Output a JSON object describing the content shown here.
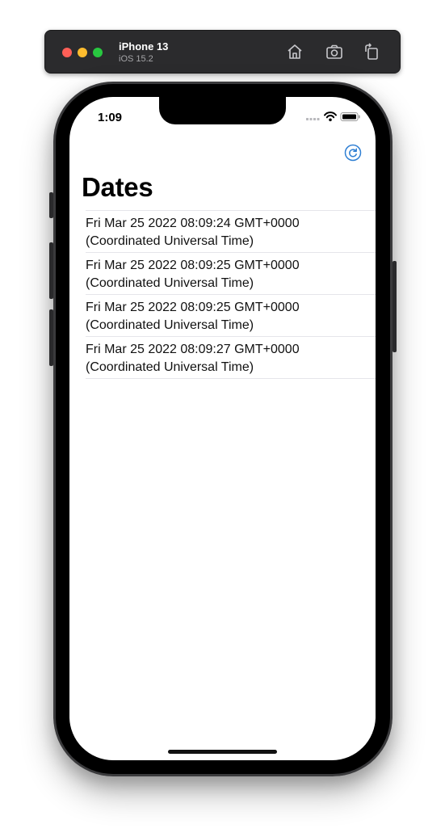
{
  "toolbar": {
    "device_name": "iPhone 13",
    "os_version": "iOS 15.2",
    "icons": [
      "home-icon",
      "screenshot-icon",
      "rotate-icon"
    ]
  },
  "status_bar": {
    "time": "1:09",
    "icons": [
      "cellular-icon",
      "wifi-icon",
      "battery-icon"
    ]
  },
  "nav": {
    "title": "Dates",
    "refresh_icon": "refresh-icon",
    "accent_color": "#2f7fd3"
  },
  "dates": [
    {
      "line1": "Fri Mar 25 2022 08:09:24 GMT+0000",
      "line2": "(Coordinated Universal Time)"
    },
    {
      "line1": "Fri Mar 25 2022 08:09:25 GMT+0000",
      "line2": "(Coordinated Universal Time)"
    },
    {
      "line1": "Fri Mar 25 2022 08:09:25 GMT+0000",
      "line2": "(Coordinated Universal Time)"
    },
    {
      "line1": "Fri Mar 25 2022 08:09:27 GMT+0000",
      "line2": "(Coordinated Universal Time)"
    }
  ]
}
